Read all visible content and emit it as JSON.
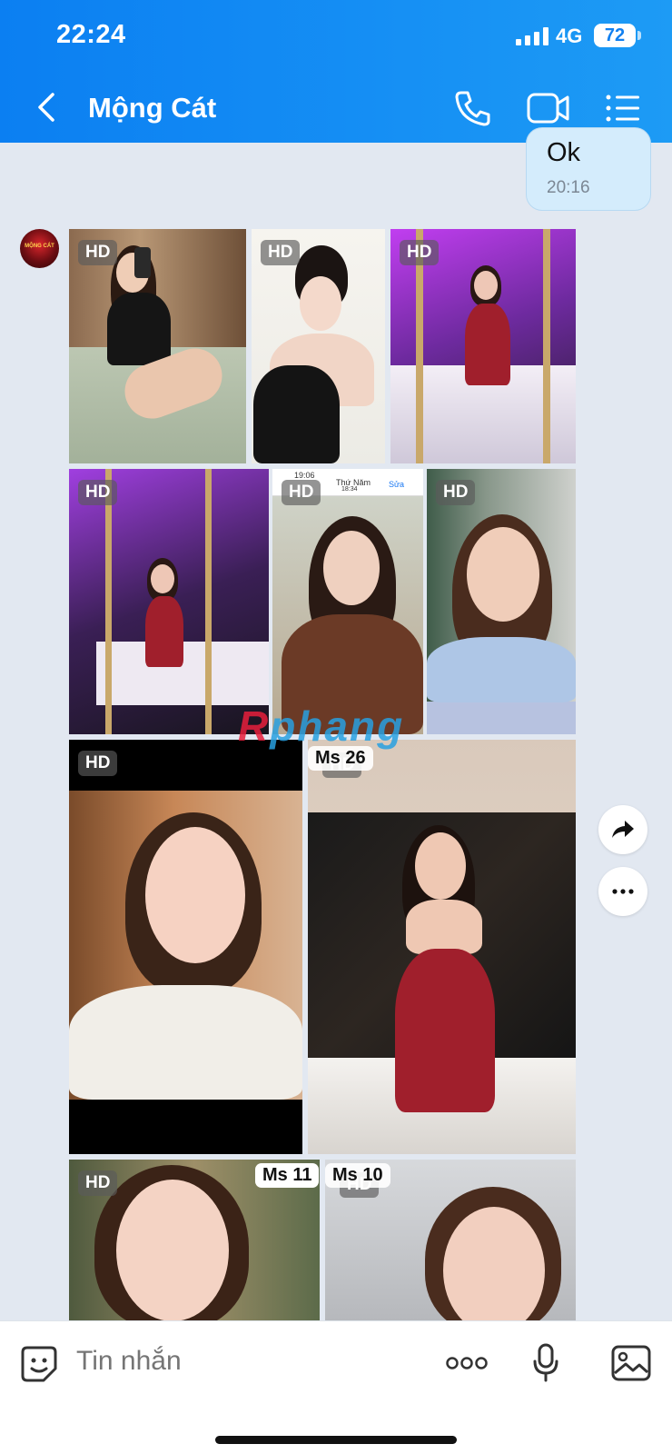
{
  "status_bar": {
    "time": "22:24",
    "network": "4G",
    "battery": "72"
  },
  "header": {
    "title": "Mộng Cát",
    "back_icon": "chevron-left-icon",
    "call_icon": "phone-icon",
    "video_icon": "video-camera-icon",
    "menu_icon": "list-menu-icon"
  },
  "previous_message": {
    "text": "Ok",
    "time": "20:16"
  },
  "avatar": {
    "label": "MỘNG CÁT"
  },
  "photos": [
    {
      "badge": "HD"
    },
    {
      "badge": "HD"
    },
    {
      "badge": "HD"
    },
    {
      "badge": "HD"
    },
    {
      "badge": "HD"
    },
    {
      "badge": "HD"
    },
    {
      "badge": "HD"
    },
    {
      "badge": "HD",
      "tag": "Ms 26"
    },
    {
      "badge": "HD",
      "tag": "Ms 11"
    },
    {
      "badge": "HD",
      "tag": "Ms 10"
    }
  ],
  "inner_screenshot": {
    "time": "19:06",
    "day": "Thứ Năm",
    "clock": "18:34",
    "edit": "Sửa"
  },
  "watermark": {
    "first": "R",
    "rest": "phang"
  },
  "side_actions": {
    "share_icon": "share-forward-icon",
    "more_icon": "more-dots-icon"
  },
  "input_bar": {
    "placeholder": "Tin nhắn",
    "sticker_icon": "sticker-icon",
    "more_icon": "more-horizontal-icon",
    "mic_icon": "microphone-icon",
    "image_icon": "image-icon"
  },
  "colors": {
    "header_start": "#0b7ff2",
    "header_end": "#1d9bf5",
    "background": "#e2e8f1",
    "bubble": "#d4ecfc"
  }
}
